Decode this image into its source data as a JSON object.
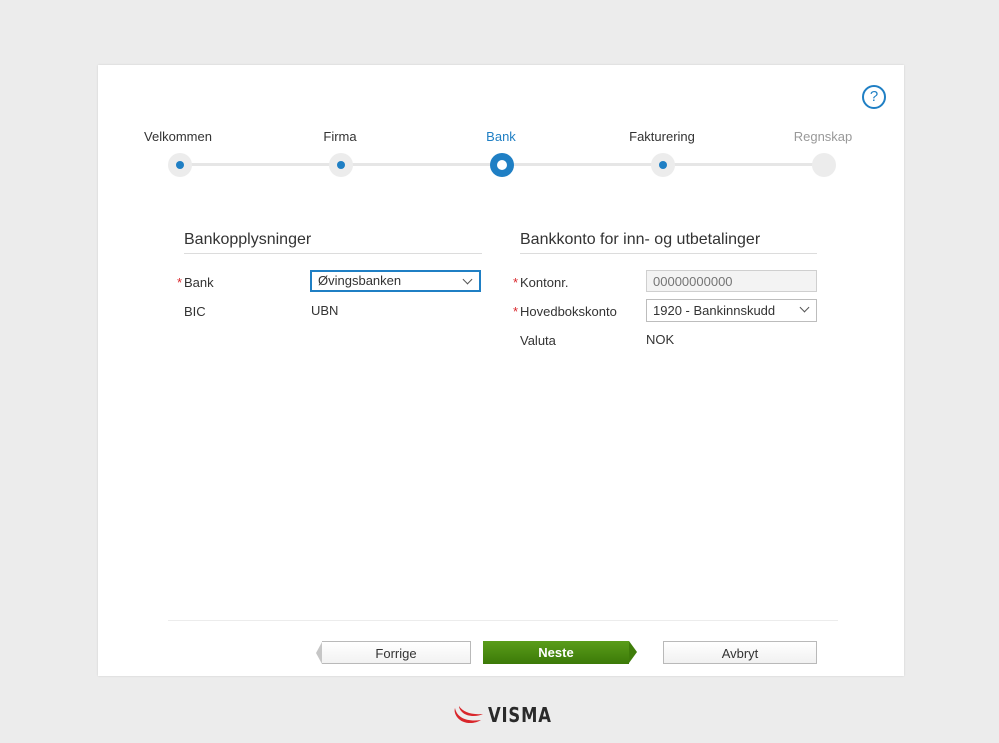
{
  "help": {
    "label": "?"
  },
  "steps": [
    {
      "label": "Velkommen",
      "state": "done"
    },
    {
      "label": "Firma",
      "state": "done"
    },
    {
      "label": "Bank",
      "state": "active"
    },
    {
      "label": "Fakturering",
      "state": "done"
    },
    {
      "label": "Regnskap",
      "state": "future"
    }
  ],
  "bank_info": {
    "title": "Bankopplysninger",
    "bank_label": "Bank",
    "bank_value": "Øvingsbanken",
    "bic_label": "BIC",
    "bic_value": "UBN"
  },
  "account": {
    "title": "Bankkonto for inn- og utbetalinger",
    "account_no_label": "Kontonr.",
    "account_no_placeholder": "00000000000",
    "ledger_label": "Hovedbokskonto",
    "ledger_value": "1920 - Bankinnskudd",
    "currency_label": "Valuta",
    "currency_value": "NOK"
  },
  "required_marker": "*",
  "buttons": {
    "prev": "Forrige",
    "next": "Neste",
    "cancel": "Avbryt"
  },
  "brand": {
    "name": "VISMA",
    "accent": "#d9262b",
    "primary": "#1f7fc4",
    "next_green": "#4a8c12"
  }
}
